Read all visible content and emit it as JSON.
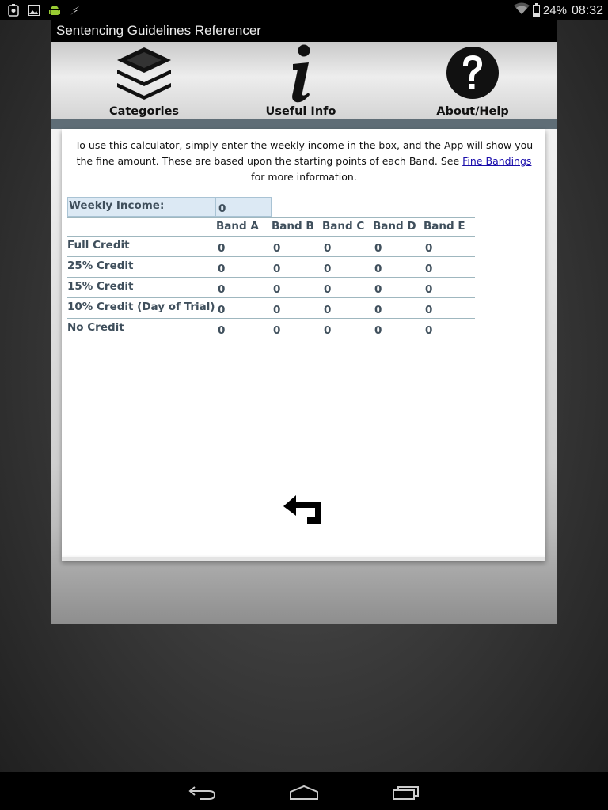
{
  "status_bar": {
    "battery": "24%",
    "time": "08:32",
    "icons": [
      "usb-debug-icon",
      "image-icon",
      "android-icon",
      "flash-icon",
      "wifi-icon",
      "battery-icon"
    ]
  },
  "app": {
    "title": "Sentencing Guidelines Referencer",
    "nav": {
      "categories": "Categories",
      "useful_info": "Useful Info",
      "about_help": "About/Help"
    },
    "intro": {
      "before_link": "To use this calculator, simply enter the weekly income in the box, and the App will show you the fine amount. These are based upon the starting points of each Band. See ",
      "link": "Fine Bandings",
      "after_link": " for more information."
    },
    "calculator": {
      "income_label": "Weekly Income:",
      "income_value": "0",
      "columns": [
        "Band A",
        "Band B",
        "Band C",
        "Band D",
        "Band E"
      ],
      "rows": [
        {
          "label": "Full Credit",
          "values": [
            "0",
            "0",
            "0",
            "0",
            "0"
          ]
        },
        {
          "label": "25% Credit",
          "values": [
            "0",
            "0",
            "0",
            "0",
            "0"
          ]
        },
        {
          "label": "15% Credit",
          "values": [
            "0",
            "0",
            "0",
            "0",
            "0"
          ]
        },
        {
          "label": "10% Credit (Day of Trial)",
          "values": [
            "0",
            "0",
            "0",
            "0",
            "0"
          ]
        },
        {
          "label": "No Credit",
          "values": [
            "0",
            "0",
            "0",
            "0",
            "0"
          ]
        }
      ]
    },
    "back_icon": "back-arrow-icon"
  },
  "system_nav": {
    "icons": [
      "back-icon",
      "home-icon",
      "recent-apps-icon"
    ]
  }
}
